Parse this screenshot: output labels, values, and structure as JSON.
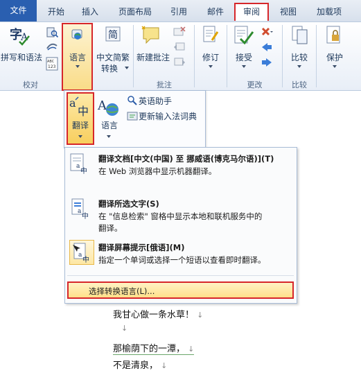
{
  "tabs": {
    "file": "文件",
    "home": "开始",
    "insert": "插入",
    "layout": "页面布局",
    "references": "引用",
    "mailings": "邮件",
    "review": "审阅",
    "view": "视图",
    "addins": "加载项"
  },
  "ribbon": {
    "spelling": "拼写和语法",
    "language": "语言",
    "chinese_convert_1": "中文简繁",
    "chinese_convert_2": "转换",
    "new_comment": "新建批注",
    "track": "修订",
    "accept": "接受",
    "compare": "比较",
    "protect": "保护",
    "group_proofing": "校对",
    "group_comments": "批注",
    "group_changes": "更改",
    "group_compare": "比较"
  },
  "language_panel": {
    "translate": "翻译",
    "language": "语言",
    "english_assistant": "英语助手",
    "update_ime": "更新输入法词典"
  },
  "translate_menu": {
    "doc_title": "翻译文档[中文(中国) 至 挪威语(博克马尔语)](T)",
    "doc_desc": "在 Web 浏览器中显示机器翻译。",
    "sel_title": "翻译所选文字(S)",
    "sel_desc_1": "在 \"信息检索\" 窗格中显示本地和联机服务中的",
    "sel_desc_2": "翻译。",
    "mini_title": "翻译屏幕提示[俄语](M)",
    "mini_desc": "指定一个单词或选择一个短语以查看即时翻译。",
    "choose": "选择转换语言(L)..."
  },
  "document": {
    "line1": "我甘心做一条水草！",
    "line2": "",
    "line3": "那榆荫下的一潭，",
    "line4": "不是清泉，"
  },
  "colors": {
    "highlight_border": "#d6262a",
    "file_tab": "#2a5fb0",
    "hover_fill": "#f8cf5e"
  }
}
